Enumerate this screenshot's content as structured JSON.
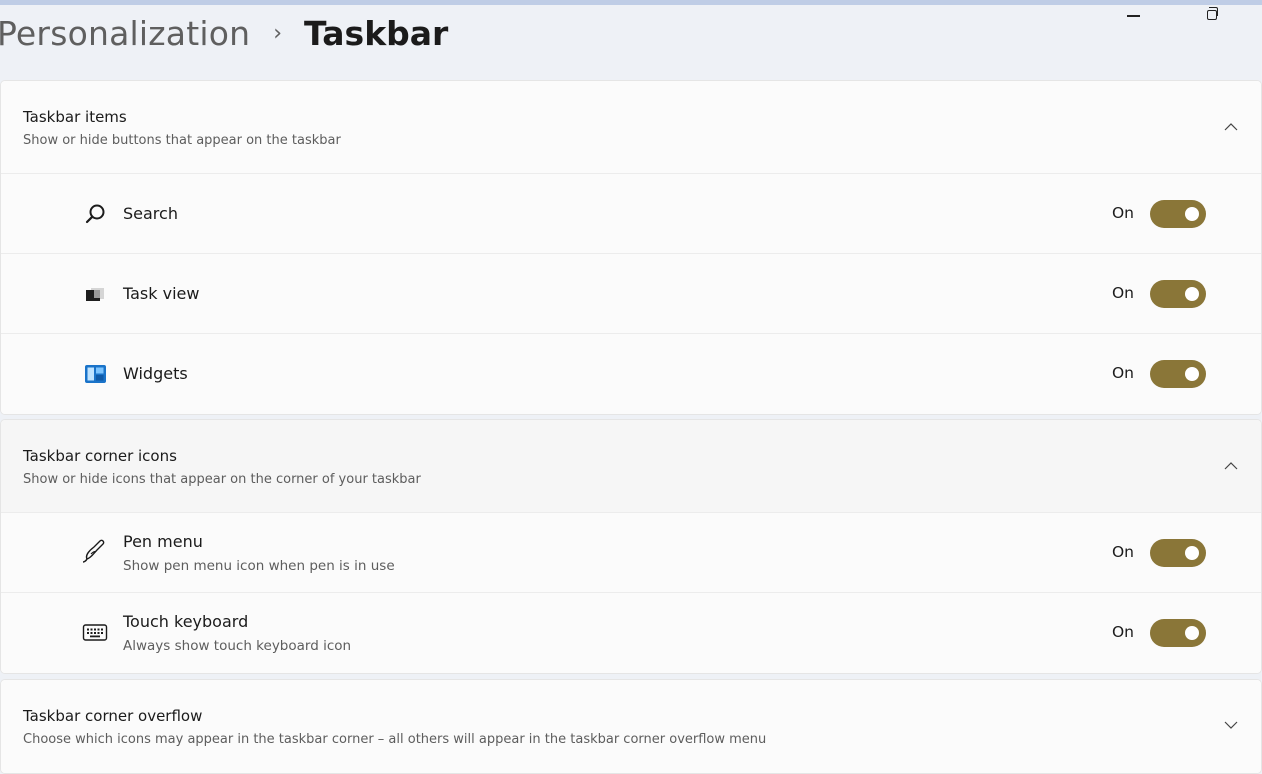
{
  "breadcrumb": {
    "parent": "Personalization",
    "separator": "›",
    "current": "Taskbar"
  },
  "window_controls": [
    "minimize-icon",
    "restore-icon"
  ],
  "colors": {
    "toggle_on": "#8a7638",
    "background": "#eef1f6",
    "card": "#fbfbfb"
  },
  "taskbar_items": {
    "title": "Taskbar items",
    "description": "Show or hide buttons that appear on the taskbar",
    "expanded": true,
    "items": [
      {
        "icon": "search-icon",
        "label": "Search",
        "state": "On"
      },
      {
        "icon": "task-view-icon",
        "label": "Task view",
        "state": "On"
      },
      {
        "icon": "widgets-icon",
        "label": "Widgets",
        "state": "On"
      }
    ]
  },
  "corner_icons": {
    "title": "Taskbar corner icons",
    "description": "Show or hide icons that appear on the corner of your taskbar",
    "expanded": true,
    "items": [
      {
        "icon": "pen-icon",
        "label": "Pen menu",
        "description": "Show pen menu icon when pen is in use",
        "state": "On"
      },
      {
        "icon": "keyboard-icon",
        "label": "Touch keyboard",
        "description": "Always show touch keyboard icon",
        "state": "On"
      }
    ]
  },
  "corner_overflow": {
    "title": "Taskbar corner overflow",
    "description": "Choose which icons may appear in the taskbar corner – all others will appear in the taskbar corner overflow menu",
    "expanded": false
  }
}
